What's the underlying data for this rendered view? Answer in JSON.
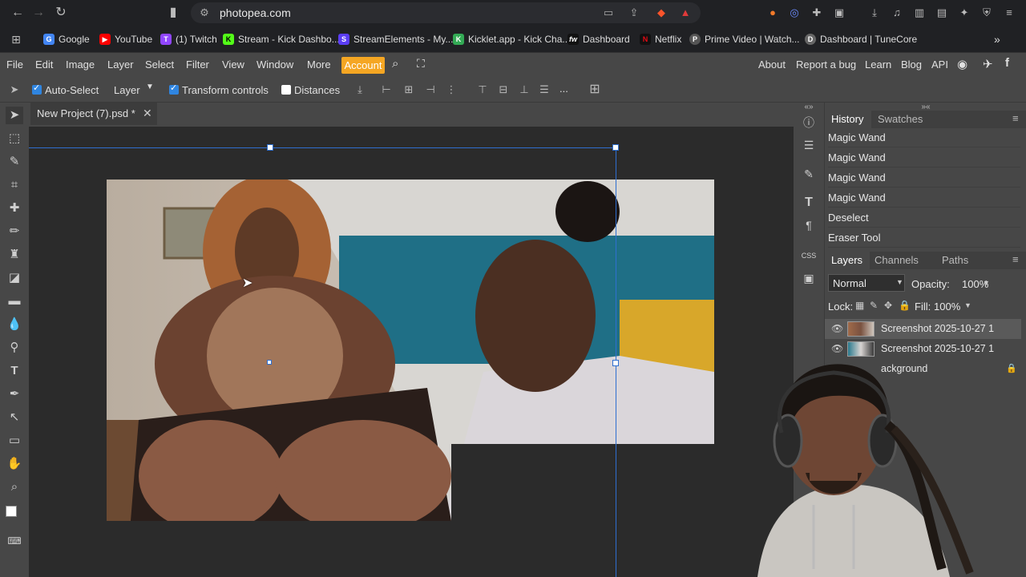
{
  "browser": {
    "url": "photopea.com",
    "bookmarks": [
      {
        "label": "Google",
        "color": "#4285f4",
        "glyph": "G"
      },
      {
        "label": "YouTube",
        "color": "#ff0000",
        "glyph": "▶"
      },
      {
        "label": "(1) Twitch",
        "color": "#9146ff",
        "glyph": "T"
      },
      {
        "label": "Stream - Kick Dashbo...",
        "color": "#53fc18",
        "glyph": "K"
      },
      {
        "label": "StreamElements - My...",
        "color": "#5b3df5",
        "glyph": "S"
      },
      {
        "label": "Kicklet.app - Kick Cha...",
        "color": "#33aa55",
        "glyph": "K"
      },
      {
        "label": "Dashboard",
        "color": "#111111",
        "glyph": "fw"
      },
      {
        "label": "Netflix",
        "color": "#e50914",
        "glyph": "N"
      },
      {
        "label": "Prime Video | Watch...",
        "color": "#00a8e1",
        "glyph": "P"
      },
      {
        "label": "Dashboard | TuneCore",
        "color": "#888888",
        "glyph": "D"
      }
    ],
    "bookmarks_overflow": "»"
  },
  "menu": {
    "items": [
      "File",
      "Edit",
      "Image",
      "Layer",
      "Select",
      "Filter",
      "View",
      "Window",
      "More"
    ],
    "account": "Account",
    "right_items": [
      "About",
      "Report a bug",
      "Learn",
      "Blog",
      "API"
    ]
  },
  "toolbar": {
    "auto_select_label": "Auto-Select",
    "auto_select_checked": true,
    "layer_select": "Layer",
    "transform_controls_label": "Transform controls",
    "transform_controls_checked": true,
    "distances_label": "Distances",
    "distances_checked": false,
    "more": "..."
  },
  "document": {
    "tab_title": "New Project (7).psd *",
    "close": "✕"
  },
  "history": {
    "tabs": [
      "History",
      "Swatches"
    ],
    "items": [
      "Magic Wand",
      "Magic Wand",
      "Magic Wand",
      "Magic Wand",
      "Deselect",
      "Eraser Tool"
    ]
  },
  "layers": {
    "tabs": [
      "Layers",
      "Channels",
      "Paths"
    ],
    "blend_mode": "Normal",
    "opacity_label": "Opacity:",
    "opacity_value": "100%",
    "lock_label": "Lock:",
    "fill_label": "Fill:",
    "fill_value": "100%",
    "rows": [
      {
        "name": "Screenshot 2025-10-27 1",
        "selected": true
      },
      {
        "name": "Screenshot 2025-10-27 1",
        "selected": false
      },
      {
        "name": "ackground",
        "selected": false
      }
    ]
  },
  "colors": {
    "accent": "#f5a623",
    "selection_blue": "#2f85e0",
    "panel_bg": "#474747",
    "workspace_bg": "#2b2b2b"
  }
}
